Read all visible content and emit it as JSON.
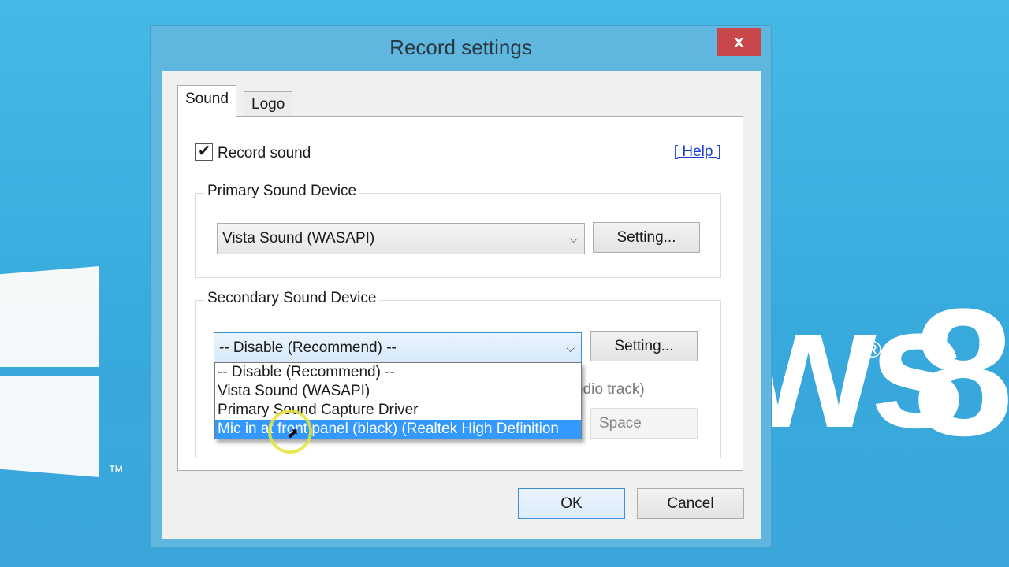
{
  "background": {
    "brand_text": "ws",
    "reg_mark": "®",
    "version": "8",
    "trademark": "™"
  },
  "window": {
    "title": "Record settings",
    "close_label": "x"
  },
  "tabs": [
    {
      "label": "Sound"
    },
    {
      "label": "Logo"
    }
  ],
  "sound": {
    "record_sound_label": "Record sound",
    "record_sound_checked": true,
    "check_mark": "✔",
    "help_link": "[ Help ]",
    "primary": {
      "group_label": "Primary Sound Device",
      "selected": "Vista Sound (WASAPI)",
      "setting_button": "Setting..."
    },
    "secondary": {
      "group_label": "Secondary Sound Device",
      "selected": "-- Disable (Recommend) --",
      "setting_button": "Setting...",
      "options": [
        "-- Disable (Recommend) --",
        "Vista Sound (WASAPI)",
        "Primary Sound Capture Driver",
        "Mic in at front panel (black) (Realtek High Definition"
      ],
      "highlighted_option": "Mic in at front panel (black) (Realtek High Definition",
      "hidden_label_fragment": "udio track)",
      "hotkey_value": "Space"
    }
  },
  "footer": {
    "ok": "OK",
    "cancel": "Cancel"
  }
}
